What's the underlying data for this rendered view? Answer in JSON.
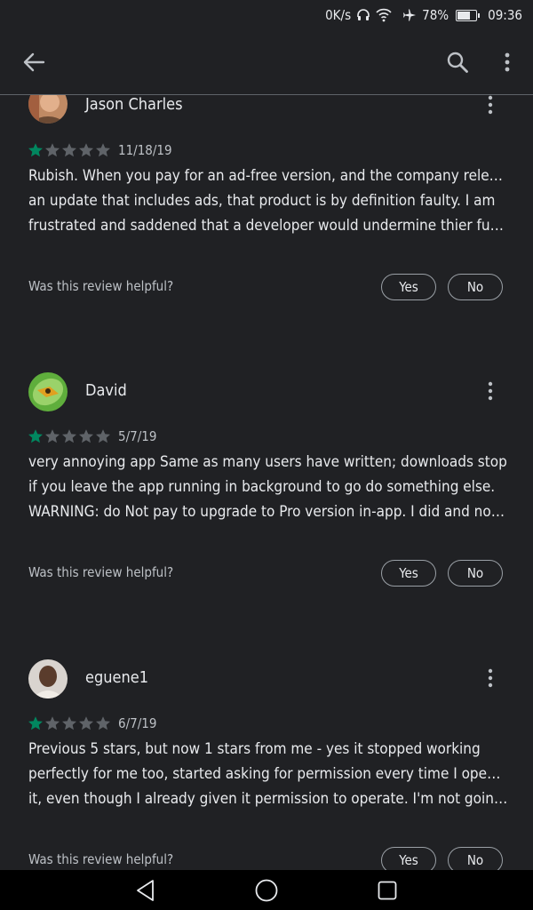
{
  "status_bar": {
    "net_speed": "0K/s",
    "battery": "78%",
    "battery_level": 0.78,
    "time": "09:36",
    "icons": [
      "headset-icon",
      "wifi-icon",
      "airplane-icon",
      "battery-icon"
    ]
  },
  "app_bar": {
    "icons": [
      "back-arrow-icon",
      "search-icon",
      "more-vert-icon"
    ]
  },
  "reviews": [
    {
      "name": "Jason Charles",
      "rating": 1,
      "date": "11/18/19",
      "lines": [
        "Rubish. When you pay for an ad-free version, and the company releases",
        "an update that includes ads, that product is by definition faulty. I am",
        "frustrated and saddened that a developer would undermine thier fundin…"
      ],
      "helpful": "Was this review helpful?",
      "yes": "Yes",
      "no": "No"
    },
    {
      "name": "David",
      "rating": 1,
      "date": "5/7/19",
      "lines": [
        "very annoying app Same as many users have written; downloads stop",
        "if you leave the app running in background to go do something else.",
        "WARNING: do Not pay to upgrade to Pro version in-app. I did and nothi…"
      ],
      "helpful": "Was this review helpful?",
      "yes": "Yes",
      "no": "No"
    },
    {
      "name": "eguene1",
      "rating": 1,
      "date": "6/7/19",
      "lines": [
        "Previous 5 stars, but now 1 stars from me - yes it stopped working",
        "perfectly for me too, started asking for permission every time I opened",
        "it, even though I already given it permission to operate. I'm not going t…"
      ],
      "helpful": "Was this review helpful?",
      "yes": "Yes",
      "no": "No"
    }
  ],
  "colors": {
    "background": "#202124",
    "star_filled": "#01875f",
    "star_empty": "#5f6368",
    "text_primary": "#e8eaed",
    "text_secondary": "#bdc1c6"
  },
  "nav_bar": {
    "icons": [
      "nav-back-icon",
      "nav-home-icon",
      "nav-recents-icon"
    ]
  }
}
